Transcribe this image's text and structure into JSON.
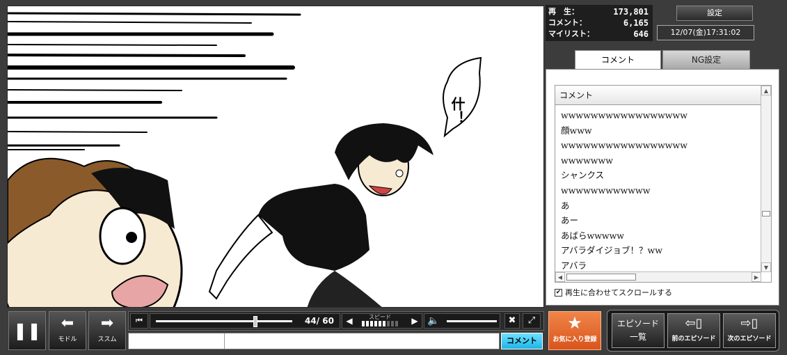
{
  "stats": {
    "views_label": "再　生：",
    "views": "173,801",
    "comments_label": "コメント：",
    "comments": "6,165",
    "mylist_label": "マイリスト：",
    "mylist": "646"
  },
  "settings_label": "設定",
  "datetime": "12/07(金)17:31:02",
  "tabs": {
    "comment": "コメント",
    "ng": "NG設定"
  },
  "comment_panel": {
    "header": "コメント",
    "comments": [
      "wwwwwwwwwwwwwwwww",
      "顔www",
      "wwwwwwwwwwwwwwwww",
      "wwwwwww",
      "シャンクス",
      "wwwwwwwwwwww",
      "あ",
      "あー",
      "あばらwwwww",
      "アバラダイジョブ！？ww",
      "アバラ"
    ],
    "scroll_sync_label": "再生に合わせてスクロールする",
    "scroll_sync_checked": true
  },
  "video": {
    "speech_text": "什！"
  },
  "controls": {
    "pause_icon": "pause-icon",
    "back_label": "モドル",
    "forward_label": "ススム",
    "time": "44/ 60",
    "seek_fraction": 0.73,
    "speed_label": "スピード",
    "speed_level": 6,
    "speed_max": 9,
    "volume_fraction": 1.0,
    "comment_button": "コメント"
  },
  "favorite": {
    "label": "お気に入り登録"
  },
  "episodes": {
    "list_line1": "エピソード",
    "list_line2": "一覧",
    "prev_label": "前のエピソード",
    "next_label": "次のエピソード"
  },
  "colors": {
    "accent": "#e0632c",
    "comment_btn": "#29bfee"
  }
}
